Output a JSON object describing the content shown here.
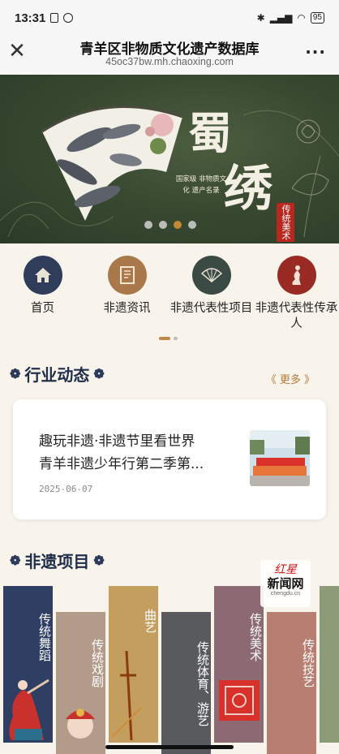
{
  "status_bar": {
    "time": "13:31",
    "battery": "95"
  },
  "nav": {
    "title": "青羊区非物质文化遗产数据库",
    "url": "45oc37bw.mh.chaoxing.com",
    "close_icon": "close-icon",
    "more_icon": "more-icon"
  },
  "banner": {
    "title_1": "蜀",
    "title_2": "绣",
    "subtitle": "国家级 非物质文化 遗产名录",
    "tag": "传统美术",
    "slide_count": 4,
    "active_slide": 3
  },
  "categories": [
    {
      "label": "首页",
      "icon": "home-icon",
      "color": "#2f3c5a"
    },
    {
      "label": "非遗资讯",
      "icon": "book-icon",
      "color": "#a9784b"
    },
    {
      "label": "非遗代表性项目",
      "icon": "fan-icon",
      "color": "#3a4a44"
    },
    {
      "label": "非遗代表性传承人",
      "icon": "figure-icon",
      "color": "#9a2a24"
    }
  ],
  "news_section": {
    "title": "行业动态",
    "more": "《 更多 》",
    "item": {
      "title": "趣玩非遗·非遗节里看世界\n青羊非遗少年行第二季第...",
      "date": "2025-06-07"
    }
  },
  "projects_section": {
    "title": "非遗项目",
    "items": [
      {
        "label": "传统舞蹈",
        "color": "#2f3e63"
      },
      {
        "label": "传统戏剧",
        "color": "#b39b8c"
      },
      {
        "label": "曲艺",
        "color": "#c39e5e"
      },
      {
        "label": "传统体育、游艺",
        "color": "#585a5d"
      },
      {
        "label": "传统美术",
        "color": "#8b6a73"
      },
      {
        "label": "传统技艺",
        "color": "#b77e71"
      },
      {
        "label": "",
        "color": "#8e9b78"
      }
    ]
  },
  "watermark": {
    "top": "红星",
    "mid": "新闻网",
    "url": "chengdu.cn"
  }
}
